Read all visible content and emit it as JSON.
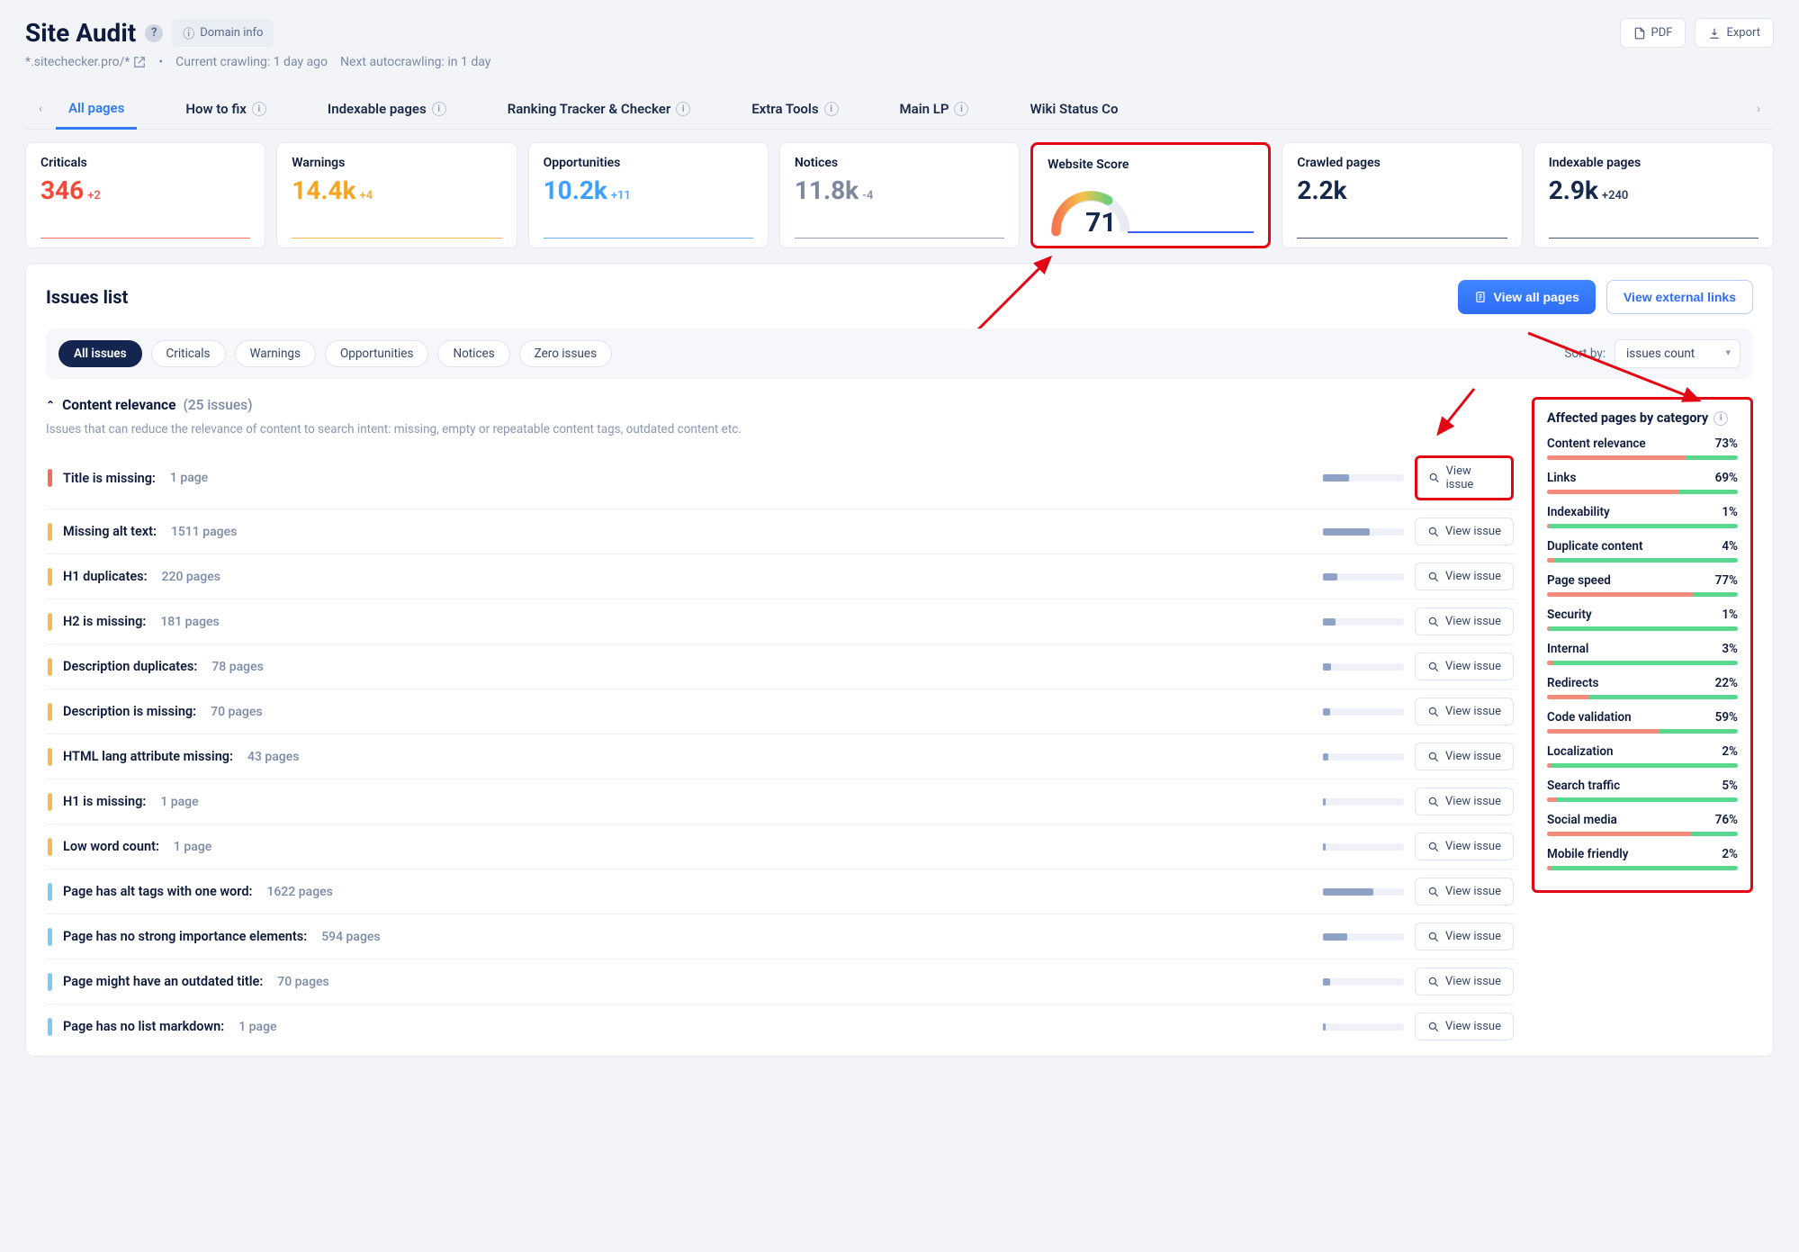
{
  "header": {
    "title": "Site Audit",
    "domain_info": "Domain info",
    "pdf": "PDF",
    "export": "Export",
    "url": "*.sitechecker.pro/*",
    "crawl_status": "Current crawling: 1 day ago",
    "next_crawl": "Next autocrawling: in 1 day"
  },
  "tabs": {
    "items": [
      {
        "label": "All pages",
        "active": true,
        "info": false
      },
      {
        "label": "How to fix",
        "active": false,
        "info": true
      },
      {
        "label": "Indexable pages",
        "active": false,
        "info": true
      },
      {
        "label": "Ranking Tracker & Checker",
        "active": false,
        "info": true
      },
      {
        "label": "Extra Tools",
        "active": false,
        "info": true
      },
      {
        "label": "Main LP",
        "active": false,
        "info": true
      },
      {
        "label": "Wiki Status Co",
        "active": false,
        "info": false
      }
    ]
  },
  "cards": [
    {
      "label": "Criticals",
      "value": "346",
      "delta": "+2",
      "color": "c-crit"
    },
    {
      "label": "Warnings",
      "value": "14.4k",
      "delta": "+4",
      "color": "c-warn"
    },
    {
      "label": "Opportunities",
      "value": "10.2k",
      "delta": "+11",
      "color": "c-opp"
    },
    {
      "label": "Notices",
      "value": "11.8k",
      "delta": "-4",
      "color": "c-note"
    },
    {
      "label": "Website Score",
      "value": "71",
      "gauge": true
    },
    {
      "label": "Crawled pages",
      "value": "2.2k",
      "delta": "",
      "color": "c-pages"
    },
    {
      "label": "Indexable pages",
      "value": "2.9k",
      "delta": "+240",
      "color": "c-pages"
    }
  ],
  "issues_panel": {
    "title": "Issues list",
    "view_all": "View all pages",
    "view_ext": "View external links",
    "filters": [
      "All issues",
      "Criticals",
      "Warnings",
      "Opportunities",
      "Notices",
      "Zero issues"
    ],
    "sort_label": "Sort by:",
    "sort_value": "issues count",
    "group": {
      "name": "Content relevance",
      "count": "(25 issues)",
      "desc": "Issues that can reduce the relevance of content to search intent: missing, empty or repeatable content tags, outdated content etc.",
      "view_issue": "View issue",
      "items": [
        {
          "sev": "crit",
          "label": "Title is missing:",
          "count": "1 page",
          "fill": 32,
          "redbox": true
        },
        {
          "sev": "warn",
          "label": "Missing alt text:",
          "count": "1511 pages",
          "fill": 58
        },
        {
          "sev": "warn",
          "label": "H1 duplicates:",
          "count": "220 pages",
          "fill": 18
        },
        {
          "sev": "warn",
          "label": "H2 is missing:",
          "count": "181 pages",
          "fill": 16
        },
        {
          "sev": "warn",
          "label": "Description duplicates:",
          "count": "78 pages",
          "fill": 10
        },
        {
          "sev": "warn",
          "label": "Description is missing:",
          "count": "70 pages",
          "fill": 9
        },
        {
          "sev": "warn",
          "label": "HTML lang attribute missing:",
          "count": "43 pages",
          "fill": 7
        },
        {
          "sev": "warn",
          "label": "H1 is missing:",
          "count": "1 page",
          "fill": 3
        },
        {
          "sev": "warn",
          "label": "Low word count:",
          "count": "1 page",
          "fill": 3
        },
        {
          "sev": "note",
          "label": "Page has alt tags with one word:",
          "count": "1622 pages",
          "fill": 62
        },
        {
          "sev": "note",
          "label": "Page has no strong importance elements:",
          "count": "594 pages",
          "fill": 30
        },
        {
          "sev": "note",
          "label": "Page might have an outdated title:",
          "count": "70 pages",
          "fill": 9
        },
        {
          "sev": "note",
          "label": "Page has no list markdown:",
          "count": "1 page",
          "fill": 3
        }
      ]
    }
  },
  "categories": {
    "title": "Affected pages by category",
    "items": [
      {
        "name": "Content relevance",
        "pct": "73%",
        "bad": 73
      },
      {
        "name": "Links",
        "pct": "69%",
        "bad": 69
      },
      {
        "name": "Indexability",
        "pct": "1%",
        "bad": 1
      },
      {
        "name": "Duplicate content",
        "pct": "4%",
        "bad": 4
      },
      {
        "name": "Page speed",
        "pct": "77%",
        "bad": 77
      },
      {
        "name": "Security",
        "pct": "1%",
        "bad": 1
      },
      {
        "name": "Internal",
        "pct": "3%",
        "bad": 3
      },
      {
        "name": "Redirects",
        "pct": "22%",
        "bad": 22
      },
      {
        "name": "Code validation",
        "pct": "59%",
        "bad": 59
      },
      {
        "name": "Localization",
        "pct": "2%",
        "bad": 2
      },
      {
        "name": "Search traffic",
        "pct": "5%",
        "bad": 5
      },
      {
        "name": "Social media",
        "pct": "76%",
        "bad": 76
      },
      {
        "name": "Mobile friendly",
        "pct": "2%",
        "bad": 2
      }
    ]
  }
}
